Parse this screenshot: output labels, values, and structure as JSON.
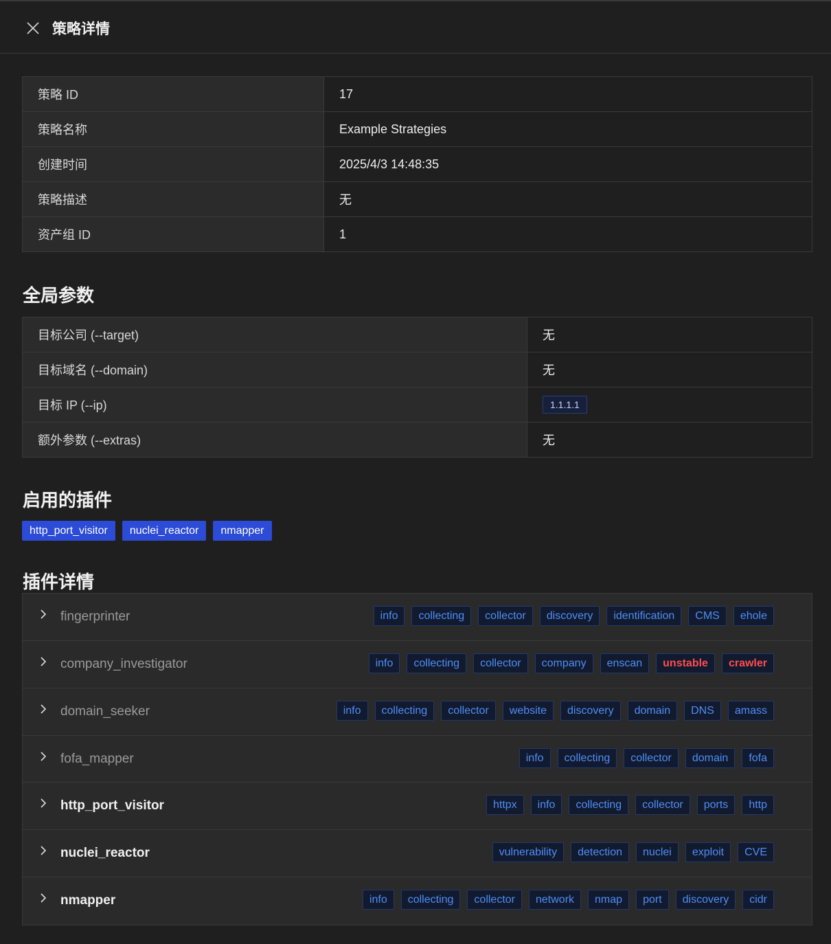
{
  "header": {
    "title": "策略详情",
    "close_icon": "close-icon"
  },
  "info": [
    {
      "key": "策略 ID",
      "value": "17"
    },
    {
      "key": "策略名称",
      "value": "Example Strategies"
    },
    {
      "key": "创建时间",
      "value": "2025/4/3 14:48:35"
    },
    {
      "key": "策略描述",
      "value": "无"
    },
    {
      "key": "资产组 ID",
      "value": "1"
    }
  ],
  "global": {
    "title": "全局参数",
    "rows": [
      {
        "key": "目标公司 (--target)",
        "value": "无"
      },
      {
        "key": "目标域名 (--domain)",
        "value": "无"
      },
      {
        "key": "目标 IP (--ip)",
        "value": "1.1.1.1"
      },
      {
        "key": "额外参数 (--extras)",
        "value": "无"
      }
    ]
  },
  "enabled": {
    "title": "启用的插件",
    "plugins": [
      "http_port_visitor",
      "nuclei_reactor",
      "nmapper"
    ]
  },
  "details": {
    "title": "插件详情",
    "plugins": [
      {
        "name": "fingerprinter",
        "tags": [
          "info",
          "collecting",
          "collector",
          "discovery",
          "identification",
          "CMS",
          "ehole"
        ]
      },
      {
        "name": "company_investigator",
        "tags": [
          "info",
          "collecting",
          "collector",
          "company",
          "enscan",
          "unstable",
          "crawler"
        ]
      },
      {
        "name": "domain_seeker",
        "tags": [
          "info",
          "collecting",
          "collector",
          "website",
          "discovery",
          "domain",
          "DNS",
          "amass"
        ]
      },
      {
        "name": "fofa_mapper",
        "tags": [
          "info",
          "collecting",
          "collector",
          "domain",
          "fofa"
        ]
      },
      {
        "name": "http_port_visitor",
        "tags": [
          "httpx",
          "info",
          "collecting",
          "collector",
          "ports",
          "http"
        ]
      },
      {
        "name": "nuclei_reactor",
        "tags": [
          "vulnerability",
          "detection",
          "nuclei",
          "exploit",
          "CVE"
        ]
      },
      {
        "name": "nmapper",
        "tags": [
          "info",
          "collecting",
          "collector",
          "network",
          "nmap",
          "port",
          "discovery",
          "cidr"
        ]
      }
    ]
  },
  "colors": {
    "accent": "#2c4bd6",
    "tag_text": "#4f8ef7",
    "warn": "#ff4d4f"
  }
}
